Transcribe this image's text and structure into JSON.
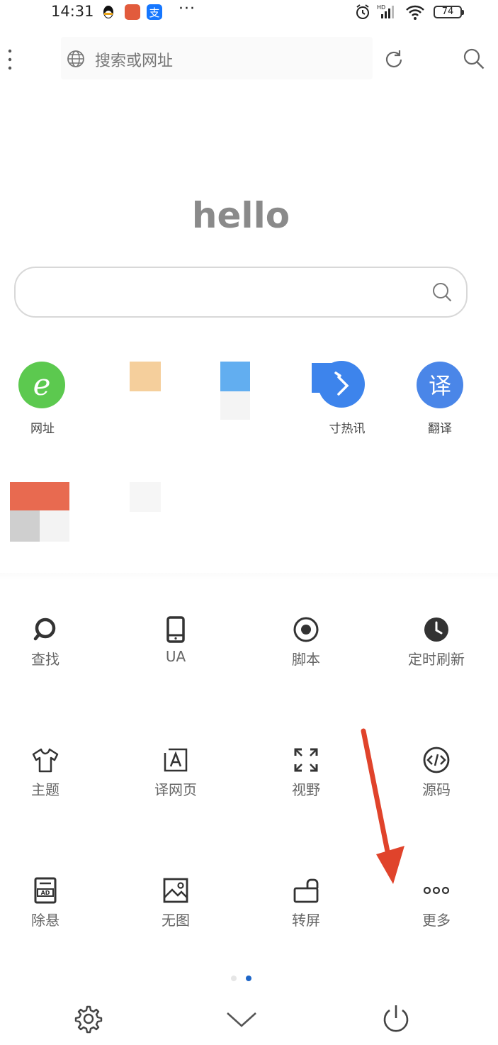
{
  "status_bar": {
    "time": "14:31",
    "more": "···",
    "battery": "74"
  },
  "top_bar": {
    "search_placeholder": "搜索或网址"
  },
  "home": {
    "title": "hello",
    "search_placeholder": ""
  },
  "shortcuts": [
    {
      "label": "网址",
      "icon": "e-browser-icon",
      "color": "#5cc94f"
    },
    {
      "label": "",
      "icon": "blurred-tile-icon",
      "color": "#f5cf9c"
    },
    {
      "label": "",
      "icon": "blurred-tile-icon",
      "color": "#62aef0"
    },
    {
      "label": "寸热讯",
      "icon": "hot-news-icon",
      "color": "#3d84ec"
    },
    {
      "label": "翻译",
      "icon": "translate-icon",
      "color": "#4a86e8",
      "glyph": "译"
    }
  ],
  "menu": {
    "items": [
      {
        "label": "查找",
        "icon": "find-icon"
      },
      {
        "label": "UA",
        "icon": "phone-ua-icon"
      },
      {
        "label": "脚本",
        "icon": "script-icon"
      },
      {
        "label": "定时刷新",
        "icon": "clock-icon"
      },
      {
        "label": "主题",
        "icon": "tshirt-icon"
      },
      {
        "label": "译网页",
        "icon": "translate-page-icon"
      },
      {
        "label": "视野",
        "icon": "fullscreen-icon"
      },
      {
        "label": "源码",
        "icon": "code-icon"
      },
      {
        "label": "除悬",
        "icon": "remove-float-icon"
      },
      {
        "label": "无图",
        "icon": "no-image-icon"
      },
      {
        "label": "转屏",
        "icon": "rotate-screen-icon"
      },
      {
        "label": "更多",
        "icon": "more-icon"
      }
    ]
  },
  "pager": {
    "pages": 2,
    "current": 2,
    "active_color": "#1e66c8"
  },
  "bottom_bar": [
    "settings-icon",
    "collapse-chevron-icon",
    "power-icon"
  ],
  "colors": {
    "annotation_arrow": "#e0432b"
  }
}
